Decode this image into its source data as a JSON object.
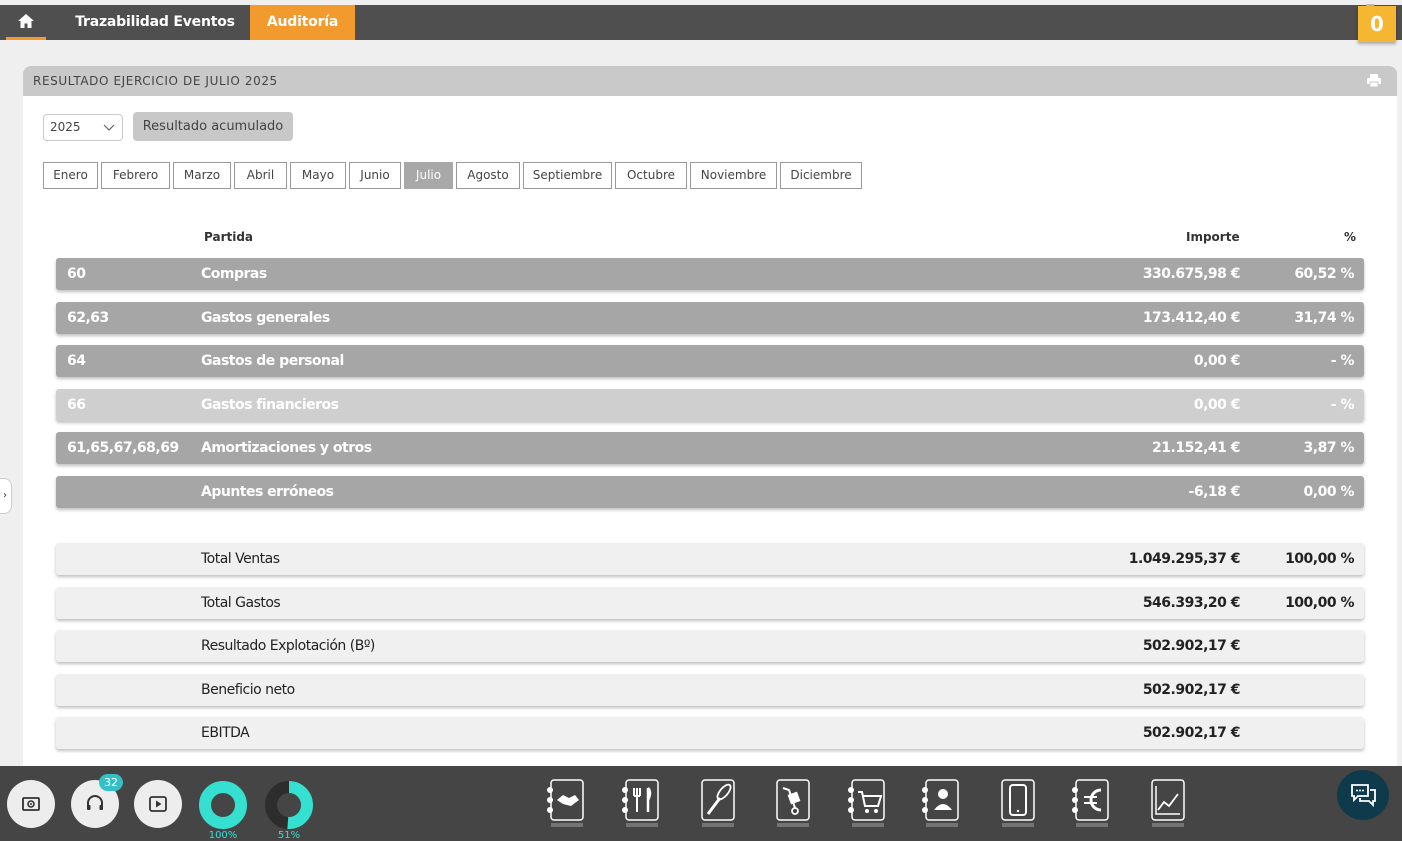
{
  "nav": {
    "home_icon": "home-icon",
    "tabs": [
      {
        "label": "Trazabilidad Eventos"
      },
      {
        "label": "Auditoría",
        "active": true
      }
    ],
    "notification_count": "0"
  },
  "panel": {
    "title": "RESULTADO EJERCICIO DE JULIO 2025",
    "print_icon": "print-icon",
    "year_selected": "2025",
    "accumulated_button": "Resultado acumulado",
    "months": [
      "Enero",
      "Febrero",
      "Marzo",
      "Abril",
      "Mayo",
      "Junio",
      "Julio",
      "Agosto",
      "Septiembre",
      "Octubre",
      "Noviembre",
      "Diciembre"
    ],
    "active_month": "Julio"
  },
  "table": {
    "headers": {
      "partida": "Partida",
      "importe": "Importe",
      "pct": "%"
    },
    "rows": [
      {
        "code": "60",
        "name": "Compras",
        "amount": "330.675,98 €",
        "pct": "60,52 %"
      },
      {
        "code": "62,63",
        "name": "Gastos generales",
        "amount": "173.412,40 €",
        "pct": "31,74 %"
      },
      {
        "code": "64",
        "name": "Gastos de personal",
        "amount": "0,00 €",
        "pct": "- %"
      },
      {
        "code": "66",
        "name": "Gastos financieros",
        "amount": "0,00 €",
        "pct": "- %"
      },
      {
        "code": "61,65,67,68,69",
        "name": "Amortizaciones y otros",
        "amount": "21.152,41 €",
        "pct": "3,87 %"
      },
      {
        "code": "",
        "name": "Apuntes erróneos",
        "amount": "-6,18 €",
        "pct": "0,00 %"
      }
    ],
    "totals": [
      {
        "name": "Total Ventas",
        "amount": "1.049.295,37 €",
        "pct": "100,00 %"
      },
      {
        "name": "Total Gastos",
        "amount": "546.393,20 €",
        "pct": "100,00 %"
      },
      {
        "name": "Resultado Explotación (Bº)",
        "amount": "502.902,17 €",
        "pct": ""
      },
      {
        "name": "Beneficio neto",
        "amount": "502.902,17 €",
        "pct": ""
      },
      {
        "name": "EBITDA",
        "amount": "502.902,17 €",
        "pct": ""
      }
    ]
  },
  "bottom": {
    "support_badge": "32",
    "gauges": [
      {
        "label": "100%",
        "value": 1.0
      },
      {
        "label": "51%",
        "value": 0.51
      }
    ],
    "modules": [
      "handshake-icon",
      "restaurant-icon",
      "whisk-icon",
      "hand-truck-icon",
      "shopping-cart-icon",
      "contacts-icon",
      "mobile-icon",
      "euro-icon",
      "chart-icon"
    ]
  },
  "colors": {
    "accent": "#f39a2e",
    "topbar": "#4f4f4f",
    "row_dark": "#a6a6a6",
    "row_light": "#cfcfcf",
    "gauge": "#35e0d0",
    "badge": "#35c0c7",
    "chat": "#0e3a4c"
  }
}
